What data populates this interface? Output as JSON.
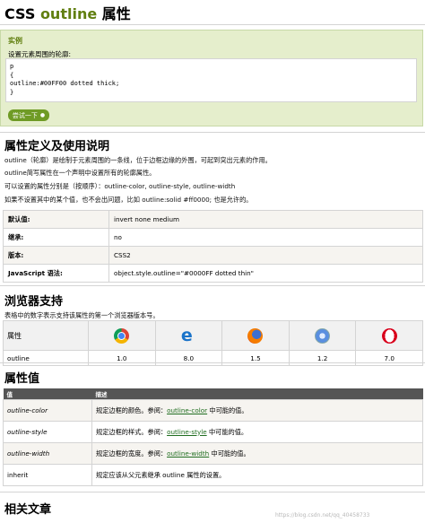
{
  "page": {
    "title_prefix": "CSS ",
    "title_keyword": "outline",
    "title_suffix": " 属性"
  },
  "example": {
    "label": "实例",
    "desc": "设置元素周围的轮廓:",
    "code_lines": [
      "p",
      "{",
      "outline:#00FF00 dotted thick;",
      "}"
    ],
    "try_button": "尝试一下",
    "try_button_dot": "●"
  },
  "definition": {
    "heading": "属性定义及使用说明",
    "paragraphs": [
      "outline（轮廓）是绘制于元素周围的一条线，位于边框边缘的外围，可起到突出元素的作用。",
      "outline简写属性在一个声明中设置所有的轮廓属性。",
      "可以设置的属性分别是（按顺序）：outline-color, outline-style, outline-width",
      "如果不设置其中的某个值，也不会出问题，比如 outline:solid #ff0000; 也是允许的。"
    ],
    "table": [
      {
        "key": "默认值:",
        "value": "invert none medium"
      },
      {
        "key": "继承:",
        "value": "no"
      },
      {
        "key": "版本:",
        "value": "CSS2"
      },
      {
        "key": "JavaScript 语法:",
        "value": "object.style.outline=\"#0000FF dotted thin\""
      }
    ]
  },
  "browser": {
    "heading": "浏览器支持",
    "desc": "表格中的数字表示支持该属性的第一个浏览器版本号。",
    "col_header": "属性",
    "row_label": "outline",
    "browsers": [
      {
        "icon": "chrome-icon",
        "version": "1.0"
      },
      {
        "icon": "edge-icon",
        "version": "8.0"
      },
      {
        "icon": "firefox-icon",
        "version": "1.5"
      },
      {
        "icon": "safari-icon",
        "version": "1.2"
      },
      {
        "icon": "opera-icon",
        "version": "7.0"
      }
    ]
  },
  "values": {
    "heading": "属性值",
    "col_value": "值",
    "col_desc": "描述",
    "rows": [
      {
        "value": "outline-color",
        "pre": "规定边框的颜色。参阅：",
        "link": "outline-color",
        "post": " 中可能的值。"
      },
      {
        "value": "outline-style",
        "pre": "规定边框的样式。参阅：",
        "link": "outline-style",
        "post": " 中可能的值。"
      },
      {
        "value": "outline-width",
        "pre": "规定边框的宽度。参阅：",
        "link": "outline-width",
        "post": " 中可能的值。"
      },
      {
        "value": "inherit",
        "pre": "规定应该从父元素继承 outline 属性的设置。",
        "link": "",
        "post": ""
      }
    ]
  },
  "related": {
    "heading": "相关文章"
  },
  "watermark": "https://blog.csdn.net/qq_40458733"
}
